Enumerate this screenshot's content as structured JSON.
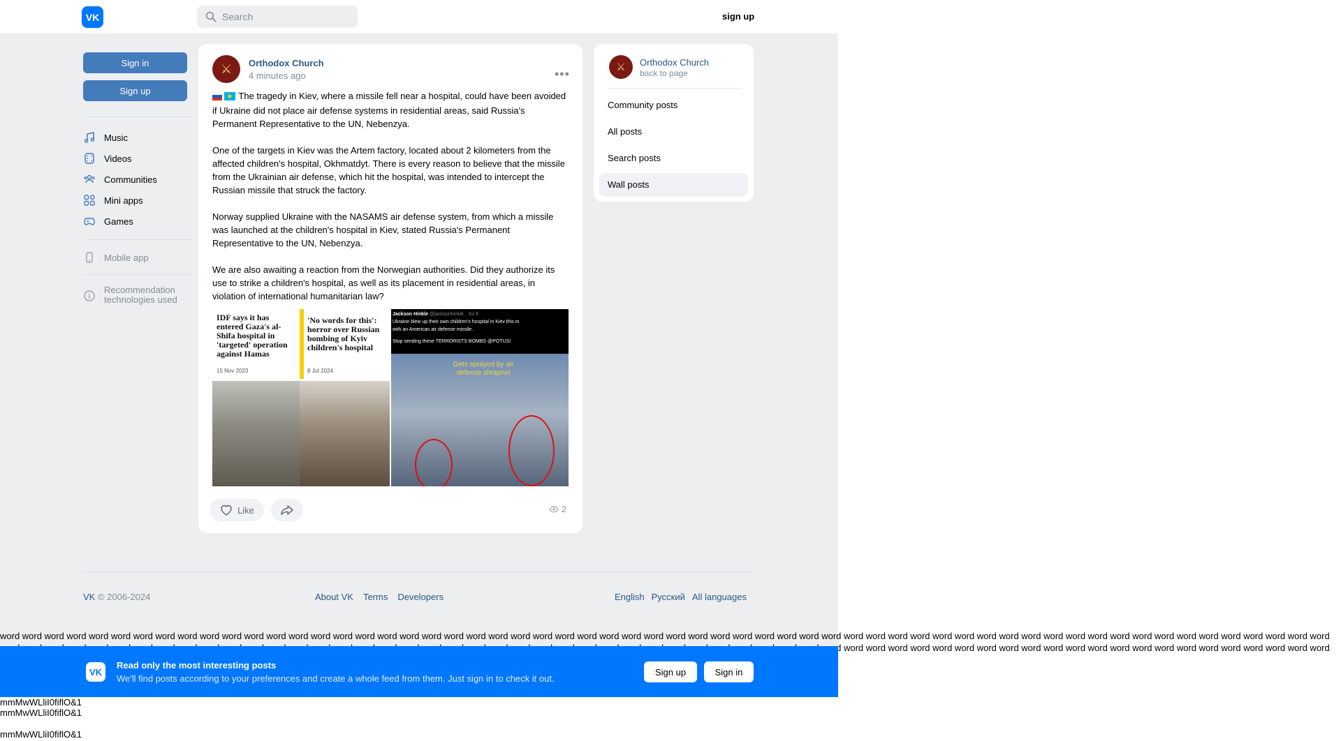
{
  "header": {
    "logo_text": "VK",
    "search_placeholder": "Search",
    "signup_label": "sign up"
  },
  "sidebar": {
    "sign_in": "Sign in",
    "sign_up": "Sign up",
    "items": [
      {
        "label": "Music",
        "icon": "music-icon"
      },
      {
        "label": "Videos",
        "icon": "videos-icon"
      },
      {
        "label": "Communities",
        "icon": "communities-icon"
      },
      {
        "label": "Mini apps",
        "icon": "mini-apps-icon"
      },
      {
        "label": "Games",
        "icon": "games-icon"
      }
    ],
    "mobile_app": "Mobile app",
    "recommendation": "Recommendation technologies used"
  },
  "post": {
    "author": "Orthodox Church",
    "time": "4 minutes ago",
    "paragraphs": [
      "The tragedy in Kiev, where a missile fell near a hospital, could have been avoided if Ukraine did not place air defense systems in residential areas, said Russia's Permanent Representative to the UN, Nebenzya.",
      "One of the targets in Kiev was the Artem factory, located about 2 kilometers from the affected children's hospital, Okhmatdyt. There is every reason to believe that the missile from the Ukrainian air defense, which hit the hospital, was intended to intercept the Russian missile that struck the factory.",
      "Norway supplied Ukraine with the NASAMS air defense system, from which a missile was launched at the children's hospital in Kiev, stated Russia's Permanent Representative to the UN, Nebenzya.",
      "We are also awaiting a reaction from the Norwegian authorities. Did they authorize its use to strike a children's hospital, as well as its placement in residential areas, in violation of international humanitarian law?"
    ],
    "photo1": {
      "headline_left": "IDF says it has entered Gaza's al-Shifa hospital in 'targeted' operation against Hamas",
      "date_left": "15 Nov 2023",
      "headline_right": "'No words for this': horror over Russian bombing of Kyiv children's hospital",
      "date_right": "8 Jul 2024"
    },
    "photo2": {
      "tweet_head": "Jackson Hinkle",
      "tweet_handle": "@jacksonhinkle · Jul 8",
      "tweet_line1": "Ukraine blew up their own children's hospital in Kiev this m",
      "tweet_line2": "with an American air defense missile.",
      "tweet_line3": "Stop sending these TERRORISTS BOMBS @POTUS!",
      "caption": "Gets sprayed by air defense shrapnel"
    },
    "like_label": "Like",
    "views": "2"
  },
  "right_panel": {
    "author": "Orthodox Church",
    "back": "back to page",
    "items": [
      "Community posts",
      "All posts",
      "Search posts",
      "Wall posts"
    ],
    "active_index": 3
  },
  "footer": {
    "copyright_brand": "VK",
    "copyright_rest": "© 2006-2024",
    "links": [
      "About VK",
      "Terms",
      "Developers"
    ],
    "languages": [
      "English",
      "Русский",
      "All languages"
    ]
  },
  "words_text": "word word word word word word word word word word word word word word word word word word word word word word word word word word word word word word word word word word word word word word word word word word word word word word word word word word word word word word word word word word word word word word word word word word word word word word word word word word word word word word word word word word word word word word word word word word word word word word word word word word word word word word word word word word word word word word word word word word word word word word word word word word word",
  "banner": {
    "logo_text": "VK",
    "title": "Read only the most interesting posts",
    "subtitle": "We'll find posts according to your preferences and create a whole feed from them. Just sign in to check it out.",
    "sign_up": "Sign up",
    "sign_in": "Sign in"
  },
  "junk_lines": [
    "mmMwWLliI0fiflO&1",
    "mmMwWLliI0fiflO&1",
    "mmMwWLliI0fiflO&1"
  ]
}
